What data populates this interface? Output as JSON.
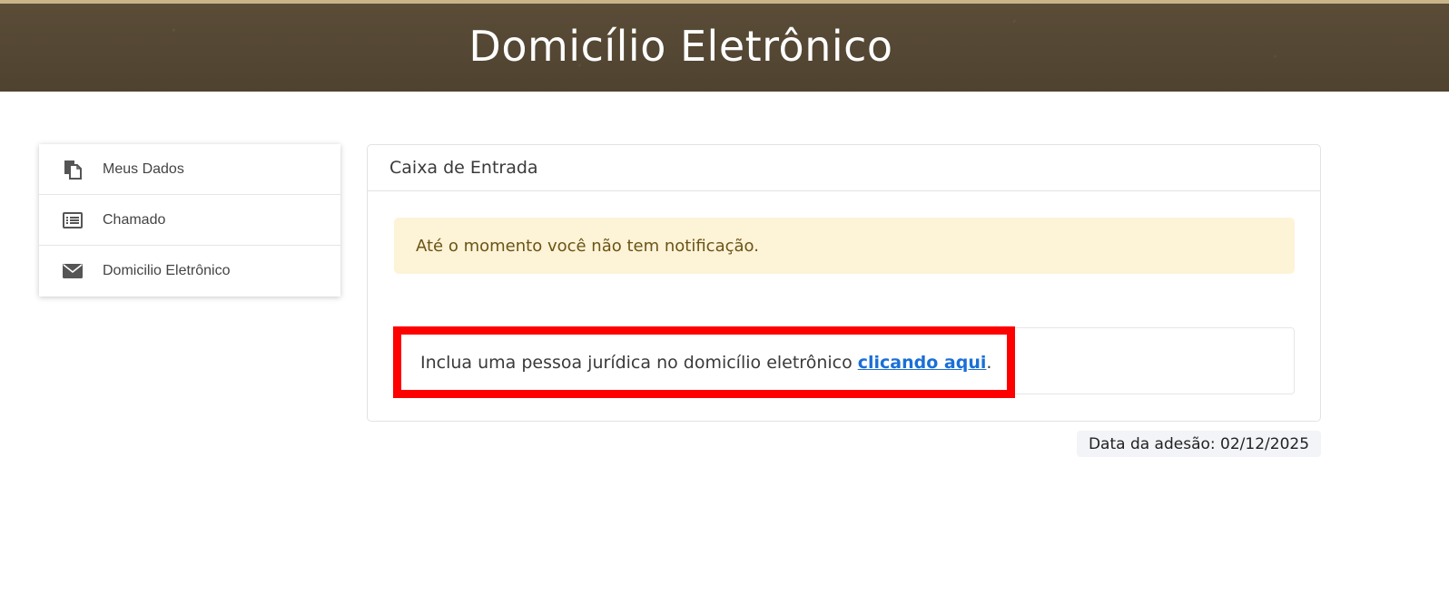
{
  "header": {
    "title": "Domicílio Eletrônico"
  },
  "sidebar": {
    "items": [
      {
        "label": "Meus Dados",
        "icon": "documents-icon"
      },
      {
        "label": "Chamado",
        "icon": "list-icon"
      },
      {
        "label": "Domicilio Eletrônico",
        "icon": "envelope-icon"
      }
    ]
  },
  "inbox": {
    "title": "Caixa de Entrada",
    "alert_text": "Até o momento você não tem notificação.",
    "include_text": "Inclua uma pessoa jurídica no domicílio eletrônico ",
    "include_link": "clicando aqui",
    "include_suffix": "."
  },
  "footer": {
    "adesao": "Data da adesão: 02/12/2025"
  },
  "colors": {
    "header_bg": "#574a36",
    "alert_bg": "#fdf3d7",
    "highlight": "#ff0000",
    "link": "#1a6fd6"
  }
}
